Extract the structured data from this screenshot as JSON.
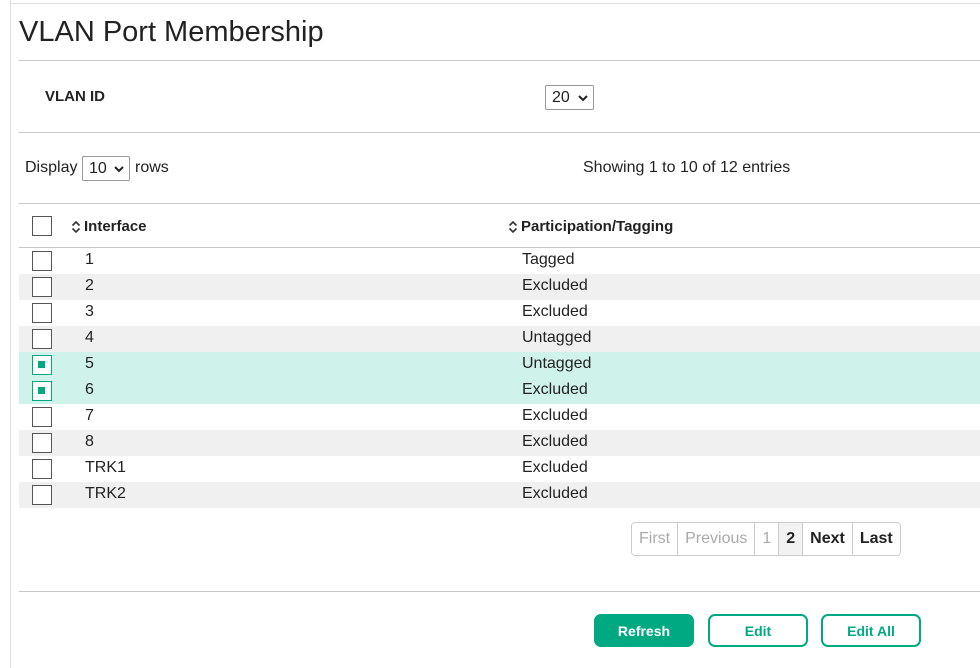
{
  "page": {
    "title": "VLAN Port Membership"
  },
  "vlan": {
    "label": "VLAN ID",
    "selected": "20"
  },
  "table_controls": {
    "display_label": "Display",
    "rows_selected": "10",
    "rows_label": "rows",
    "showing": "Showing 1 to 10 of 12 entries"
  },
  "table": {
    "headers": {
      "interface": "Interface",
      "participation": "Participation/Tagging"
    },
    "rows": [
      {
        "interface": "1",
        "participation": "Tagged",
        "selected": false
      },
      {
        "interface": "2",
        "participation": "Excluded",
        "selected": false
      },
      {
        "interface": "3",
        "participation": "Excluded",
        "selected": false
      },
      {
        "interface": "4",
        "participation": "Untagged",
        "selected": false
      },
      {
        "interface": "5",
        "participation": "Untagged",
        "selected": true
      },
      {
        "interface": "6",
        "participation": "Excluded",
        "selected": true
      },
      {
        "interface": "7",
        "participation": "Excluded",
        "selected": false
      },
      {
        "interface": "8",
        "participation": "Excluded",
        "selected": false
      },
      {
        "interface": "TRK1",
        "participation": "Excluded",
        "selected": false
      },
      {
        "interface": "TRK2",
        "participation": "Excluded",
        "selected": false
      }
    ]
  },
  "pagination": {
    "first": "First",
    "previous": "Previous",
    "page1": "1",
    "page2": "2",
    "next": "Next",
    "last": "Last",
    "current_page": "2"
  },
  "buttons": {
    "refresh": "Refresh",
    "edit": "Edit",
    "edit_all": "Edit All"
  },
  "colors": {
    "accent": "#01a982",
    "selected_row": "#cff2ea",
    "striped_row": "#f0f0f0"
  }
}
